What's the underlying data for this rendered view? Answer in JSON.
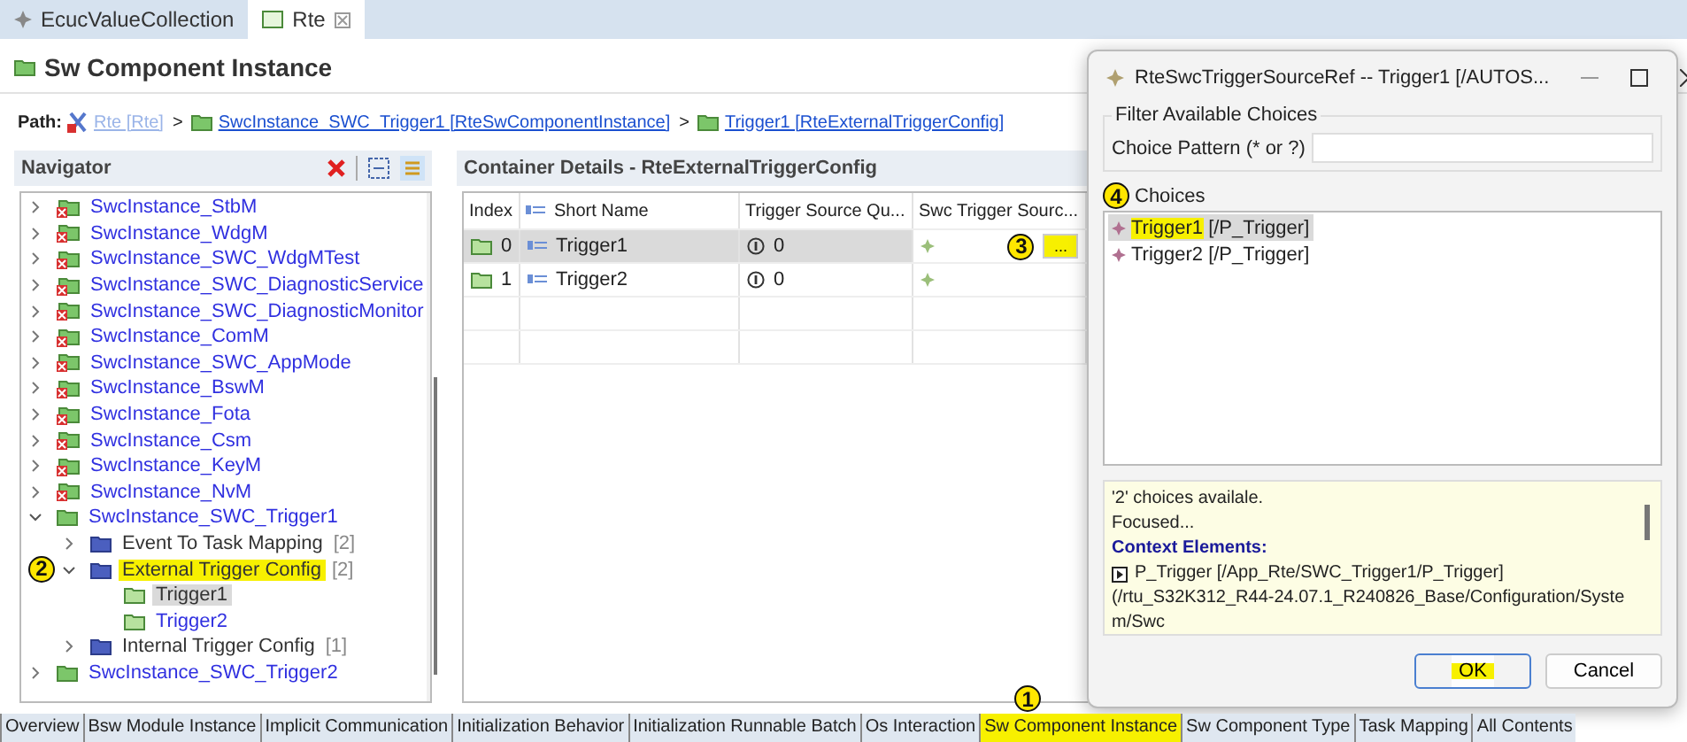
{
  "editor_tabs": [
    {
      "label": "EcucValueCollection",
      "selected": false,
      "kind": "ecuc"
    },
    {
      "label": "Rte",
      "selected": true,
      "kind": "rte"
    }
  ],
  "page_title": "Sw Component Instance",
  "path": {
    "label": "Path:",
    "segments": [
      {
        "text": "Rte [Rte]",
        "kind": "module",
        "disabled": true
      },
      {
        "separator": ">",
        "text": "SwcInstance_SWC_Trigger1 [RteSwComponentInstance]",
        "kind": "folder",
        "disabled": false
      },
      {
        "separator": ">",
        "text": "Trigger1 [RteExternalTriggerConfig]",
        "kind": "folder",
        "disabled": false
      }
    ]
  },
  "navigator": {
    "title": "Navigator",
    "tree": [
      {
        "label": "SwcInstance_StbM",
        "kind": "instance",
        "expanded": false,
        "selected": false,
        "highlighted": false
      },
      {
        "label": "SwcInstance_WdgM",
        "kind": "instance",
        "expanded": false,
        "selected": false,
        "highlighted": false
      },
      {
        "label": "SwcInstance_SWC_WdgMTest",
        "kind": "instance",
        "expanded": false,
        "selected": false,
        "highlighted": false
      },
      {
        "label": "SwcInstance_SWC_DiagnosticService",
        "kind": "instance",
        "expanded": false,
        "selected": false,
        "highlighted": false
      },
      {
        "label": "SwcInstance_SWC_DiagnosticMonitor",
        "kind": "instance",
        "expanded": false,
        "selected": false,
        "highlighted": false
      },
      {
        "label": "SwcInstance_ComM",
        "kind": "instance",
        "expanded": false,
        "selected": false,
        "highlighted": false
      },
      {
        "label": "SwcInstance_SWC_AppMode",
        "kind": "instance",
        "expanded": false,
        "selected": false,
        "highlighted": false
      },
      {
        "label": "SwcInstance_BswM",
        "kind": "instance",
        "expanded": false,
        "selected": false,
        "highlighted": false
      },
      {
        "label": "SwcInstance_Fota",
        "kind": "instance",
        "expanded": false,
        "selected": false,
        "highlighted": false
      },
      {
        "label": "SwcInstance_Csm",
        "kind": "instance",
        "expanded": false,
        "selected": false,
        "highlighted": false
      },
      {
        "label": "SwcInstance_KeyM",
        "kind": "instance",
        "expanded": false,
        "selected": false,
        "highlighted": false
      },
      {
        "label": "SwcInstance_NvM",
        "kind": "instance",
        "expanded": false,
        "selected": false,
        "highlighted": false
      },
      {
        "label": "SwcInstance_SWC_Trigger1",
        "kind": "instance_ok",
        "expanded": true,
        "selected": false,
        "highlighted": false,
        "children": [
          {
            "label": "Event To Task Mapping",
            "count": "[2]",
            "kind": "group",
            "expanded": false,
            "selected": false,
            "highlighted": false
          },
          {
            "label": "External Trigger Config",
            "count": "[2]",
            "kind": "group",
            "expanded": true,
            "selected": false,
            "highlighted": true,
            "marker": "2",
            "children": [
              {
                "label": "Trigger1",
                "kind": "container",
                "selected": true,
                "highlighted": false
              },
              {
                "label": "Trigger2",
                "kind": "container",
                "selected": false,
                "highlighted": false
              }
            ]
          },
          {
            "label": "Internal Trigger Config",
            "count": "[1]",
            "kind": "group",
            "expanded": false,
            "selected": false,
            "highlighted": false
          }
        ]
      },
      {
        "label": "SwcInstance_SWC_Trigger2",
        "kind": "instance_ok",
        "expanded": false,
        "selected": false,
        "highlighted": false
      }
    ]
  },
  "details": {
    "title": "Container Details - RteExternalTriggerConfig",
    "columns": [
      "Index",
      "Short Name",
      "Trigger Source Qu...",
      "Swc Trigger Sourc..."
    ],
    "rows": [
      {
        "index": "0",
        "short_name": "Trigger1",
        "trigger_source": "0",
        "selected": true,
        "edit_button": "...",
        "marker": "3"
      },
      {
        "index": "1",
        "short_name": "Trigger2",
        "trigger_source": "0",
        "selected": false
      }
    ]
  },
  "dialog": {
    "title": "RteSwcTriggerSourceRef -- Trigger1 [/AUTOS...",
    "filter_group": "Filter Available Choices",
    "pattern_label": "Choice Pattern (* or ?)",
    "choices_label": "Choices",
    "choices_marker": "4",
    "choices": [
      {
        "label": "Trigger1",
        "path": "[/P_Trigger]",
        "selected": true,
        "highlighted": true
      },
      {
        "label": "Trigger2",
        "path": "[/P_Trigger]",
        "selected": false,
        "highlighted": false
      }
    ],
    "info": [
      {
        "kind": "text",
        "text": "'2' choices availale."
      },
      {
        "kind": "text",
        "text": "Focused..."
      },
      {
        "kind": "heading",
        "text": "Context Elements:"
      },
      {
        "kind": "element",
        "text": "P_Trigger [/App_Rte/SWC_Trigger1/P_Trigger]"
      },
      {
        "kind": "text",
        "text": "(/rtu_S32K312_R44-24.07.1_R240826_Base/Configuration/System/Swc"
      }
    ],
    "buttons": [
      {
        "label": "OK",
        "highlighted": true,
        "default": true
      },
      {
        "label": "Cancel",
        "highlighted": false,
        "default": false
      }
    ]
  },
  "bottom_tabs": [
    {
      "label": "Overview",
      "highlighted": false
    },
    {
      "label": "Bsw Module Instance",
      "highlighted": false
    },
    {
      "label": "Implicit Communication",
      "highlighted": false
    },
    {
      "label": "Initialization Behavior",
      "highlighted": false
    },
    {
      "label": "Initialization Runnable Batch",
      "highlighted": false
    },
    {
      "label": "Os Interaction",
      "highlighted": false
    },
    {
      "label": "Sw Component Instance",
      "highlighted": true,
      "marker": "1"
    },
    {
      "label": "Sw Component Type",
      "highlighted": false
    },
    {
      "label": "Task Mapping",
      "highlighted": false
    },
    {
      "label": "All Contents",
      "highlighted": false
    }
  ]
}
